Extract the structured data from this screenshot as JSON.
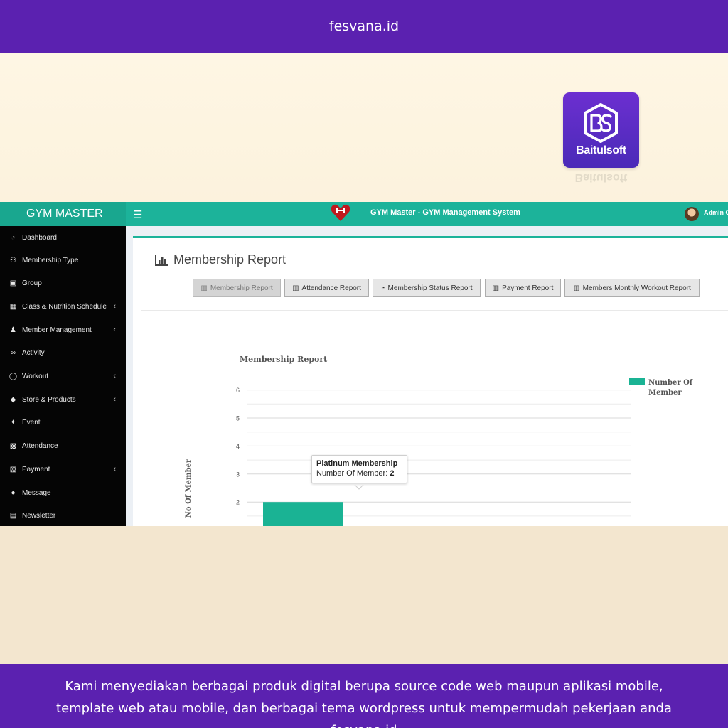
{
  "banner": {
    "site": "fesvana.id",
    "footer_lines": [
      "Kami menyediakan berbagai produk digital berupa source code web maupun aplikasi mobile,",
      "template web atau mobile, dan berbagai tema wordpress untuk mempermudah pekerjaan anda",
      "fesvana.id"
    ]
  },
  "logo": {
    "text": "Baitulsoft",
    "icon": "bs-monogram-icon"
  },
  "app": {
    "brand": "GYM MASTER",
    "title": "GYM Master - GYM Management System",
    "user": "Admin G",
    "accent": "#1cb39a"
  },
  "sidebar": {
    "items": [
      {
        "label": "Dashboard",
        "icon": "dashboard-icon",
        "chevron": false
      },
      {
        "label": "Membership Type",
        "icon": "users-icon",
        "chevron": false
      },
      {
        "label": "Group",
        "icon": "group-icon",
        "chevron": false
      },
      {
        "label": "Class & Nutrition Schedule",
        "icon": "calendar-icon",
        "chevron": true
      },
      {
        "label": "Member Management",
        "icon": "user-icon",
        "chevron": true
      },
      {
        "label": "Activity",
        "icon": "bicycle-icon",
        "chevron": false
      },
      {
        "label": "Workout",
        "icon": "workout-icon",
        "chevron": true
      },
      {
        "label": "Store & Products",
        "icon": "tag-icon",
        "chevron": true
      },
      {
        "label": "Event",
        "icon": "event-icon",
        "chevron": false
      },
      {
        "label": "Attendance",
        "icon": "attendance-icon",
        "chevron": false
      },
      {
        "label": "Payment",
        "icon": "payment-icon",
        "chevron": true
      },
      {
        "label": "Message",
        "icon": "message-icon",
        "chevron": false
      },
      {
        "label": "Newsletter",
        "icon": "newsletter-icon",
        "chevron": false
      }
    ]
  },
  "report": {
    "title": "Membership Report",
    "buttons": [
      {
        "label": "Membership Report",
        "active": true
      },
      {
        "label": "Attendance Report",
        "active": false
      },
      {
        "label": "Membership Status Report",
        "active": false
      },
      {
        "label": "Payment Report",
        "active": false
      },
      {
        "label": "Members Monthly Workout Report",
        "active": false
      }
    ]
  },
  "chart_data": {
    "type": "bar",
    "title": "Membership Report",
    "ylabel": "No Of Member",
    "xlabel": "",
    "ylim": [
      0,
      6
    ],
    "yticks": [
      1,
      2,
      3,
      4,
      5,
      6
    ],
    "categories": [
      "Platinum Membership"
    ],
    "series": [
      {
        "name": "Number Of Member",
        "values": [
          2
        ],
        "color": "#1ab394"
      }
    ],
    "legend": "right",
    "grid": true,
    "tooltip": {
      "title": "Platinum Membership",
      "label": "Number Of Member:",
      "value": "2"
    }
  }
}
